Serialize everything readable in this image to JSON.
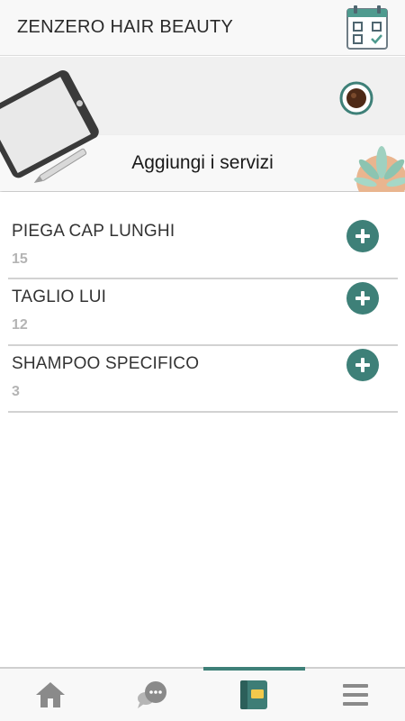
{
  "header": {
    "title": "ZENZERO HAIR BEAUTY",
    "calendar_icon": "calendar-check-icon"
  },
  "banner": {
    "title": "Aggiungi i servizi",
    "icons": [
      "tablet-illustration",
      "coffee-icon",
      "plant-illustration"
    ]
  },
  "services": [
    {
      "name": "PIEGA CAP LUNGHI",
      "value": "15"
    },
    {
      "name": "TAGLIO LUI",
      "value": "12"
    },
    {
      "name": "SHAMPOO SPECIFICO",
      "value": "3"
    }
  ],
  "bottom_nav": {
    "items": [
      "home-icon",
      "chat-icon",
      "catalog-icon",
      "menu-icon"
    ],
    "active_index": 2
  },
  "colors": {
    "accent": "#3e8078",
    "nav_icon": "#8a8a8a",
    "separator": "#d2d2d2"
  }
}
